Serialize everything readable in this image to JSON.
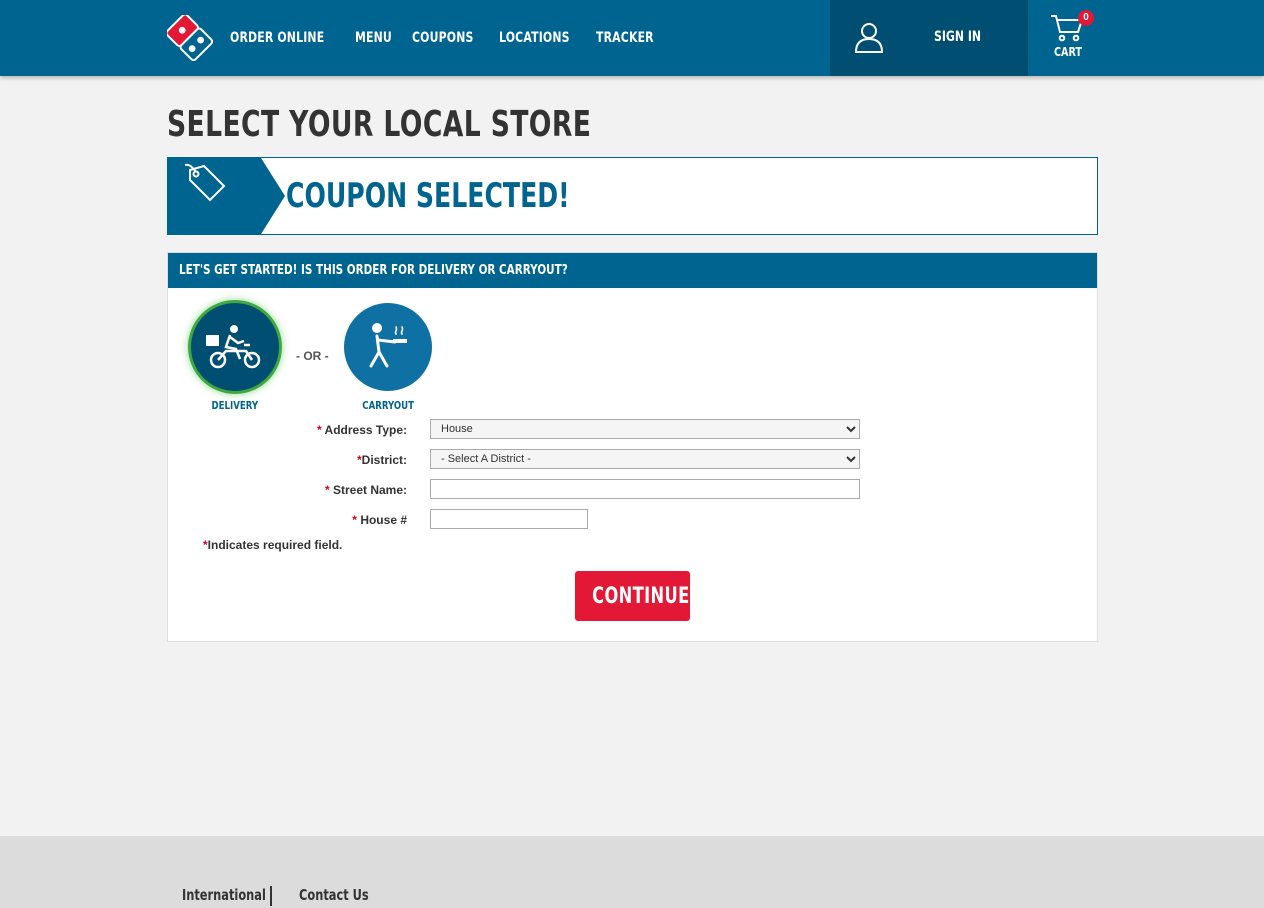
{
  "header": {
    "nav": [
      "ORDER ONLINE",
      "MENU",
      "COUPONS",
      "LOCATIONS",
      "TRACKER"
    ],
    "sign_in": "SIGN IN",
    "cart_label": "CART",
    "cart_count": "0"
  },
  "page": {
    "title": "SELECT YOUR LOCAL STORE",
    "coupon_banner": "COUPON SELECTED!"
  },
  "form": {
    "header": "LET'S GET STARTED! IS THIS ORDER FOR DELIVERY OR CARRYOUT?",
    "delivery_label": "DELIVERY",
    "carryout_label": "CARRYOUT",
    "or_text": "- OR -",
    "required_mark": "*",
    "address_type_label": "Address Type:",
    "address_type_value": "House",
    "district_label": "District:",
    "district_value": "- Select A District -",
    "street_label": "Street Name:",
    "house_label": "House #",
    "required_note": "Indicates required field.",
    "continue": "CONTINUE"
  },
  "footer": {
    "links": [
      "International",
      "Contact Us"
    ]
  },
  "colors": {
    "brand_blue": "#006491",
    "brand_red": "#e31837",
    "selected_glow": "#3fa83f"
  }
}
